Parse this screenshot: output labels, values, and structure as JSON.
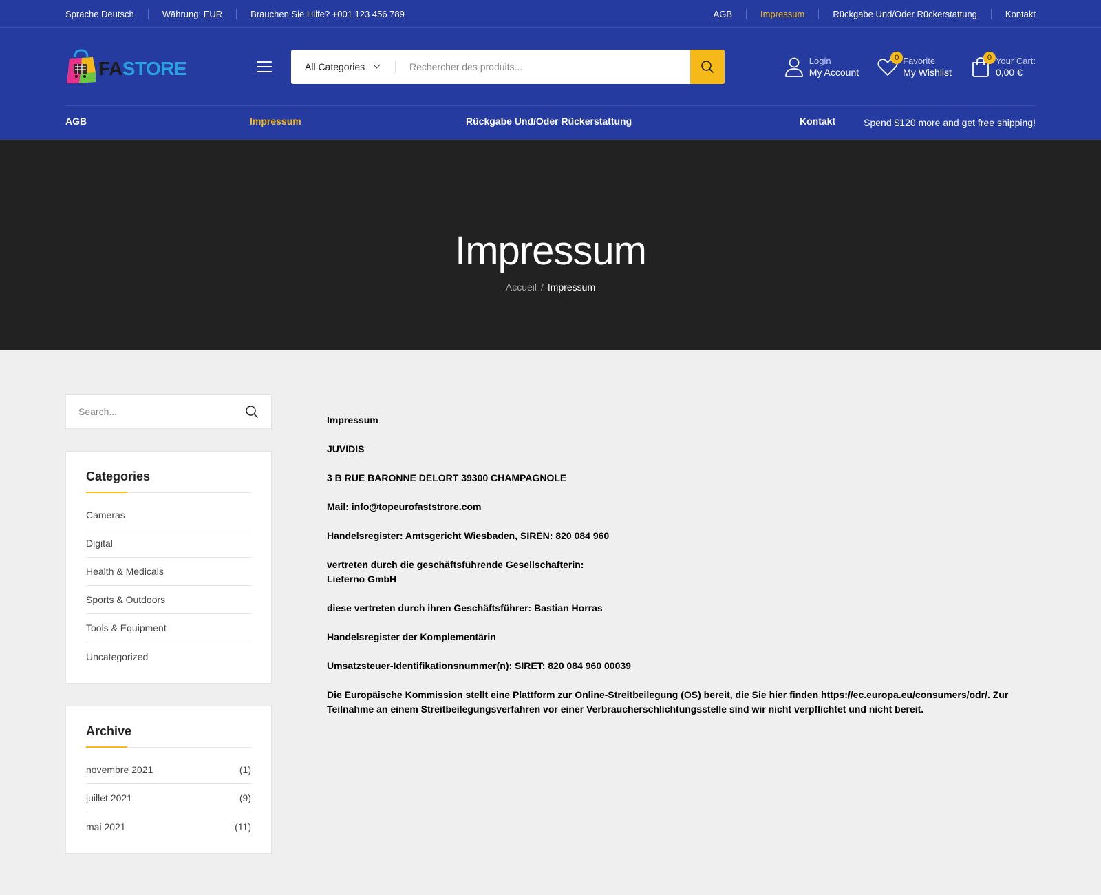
{
  "topbar": {
    "language": "Sprache Deutsch",
    "currency": "Währung: EUR",
    "help": "Brauchen Sie Hilfe? +001 123 456 789",
    "links": [
      "AGB",
      "Impressum",
      "Rückgabe Und/Oder Rückerstattung",
      "Kontakt"
    ],
    "active_link": "Impressum"
  },
  "logo": {
    "part1": "FA",
    "part2": "STORE"
  },
  "search": {
    "category": "All Categories",
    "placeholder": "Rechercher des produits..."
  },
  "account": {
    "small": "Login",
    "big": "My Account"
  },
  "wishlist": {
    "small": "Favorite",
    "big": "My Wishlist",
    "count": "0"
  },
  "cart": {
    "small": "Your Cart:",
    "big": "0,00 €",
    "count": "0"
  },
  "nav": {
    "items": [
      "AGB",
      "Impressum",
      "Rückgabe Und/Oder Rückerstattung",
      "Kontakt"
    ],
    "shipping": "Spend $120 more and get free shipping!"
  },
  "hero": {
    "title": "Impressum",
    "crumb_home": "Accueil",
    "crumb_sep": "/",
    "crumb_current": "Impressum"
  },
  "sidebar": {
    "search_placeholder": "Search...",
    "categories_title": "Categories",
    "categories": [
      "Cameras",
      "Digital",
      "Health & Medicals",
      "Sports & Outdoors",
      "Tools & Equipment",
      "Uncategorized"
    ],
    "archive_title": "Archive",
    "archive": [
      {
        "label": "novembre 2021",
        "count": "(1)"
      },
      {
        "label": "juillet 2021",
        "count": "(9)"
      },
      {
        "label": "mai 2021",
        "count": "(11)"
      }
    ]
  },
  "content": {
    "p1": "Impressum",
    "p2": "JUVIDIS",
    "p3": "3 B RUE BARONNE DELORT 39300 CHAMPAGNOLE",
    "p4": "Mail: info@topeurofaststrore.com",
    "p5": "Handelsregister: Amtsgericht Wiesbaden, SIREN: 820 084 960",
    "p6a": "vertreten durch die geschäftsführende Gesellschafterin:",
    "p6b": "Lieferno GmbH",
    "p7": "diese vertreten durch ihren Geschäftsführer: Bastian Horras",
    "p8": "Handelsregister der Komplementärin",
    "p9": "Umsatzsteuer-Identifikationsnummer(n): SIRET: 820 084 960 00039",
    "p10": "Die Europäische Kommission stellt eine Plattform zur Online-Streitbeilegung (OS) bereit, die Sie hier finden https://ec.europa.eu/consumers/odr/. Zur Teilnahme an einem Streitbeilegungsverfahren vor einer Verbraucherschlichtungsstelle sind wir nicht verpflichtet und nicht bereit."
  },
  "colors": {
    "brand_blue": "#253b9f",
    "accent": "#f5b91a",
    "hero_bg": "#222222",
    "page_bg": "#efefef"
  }
}
